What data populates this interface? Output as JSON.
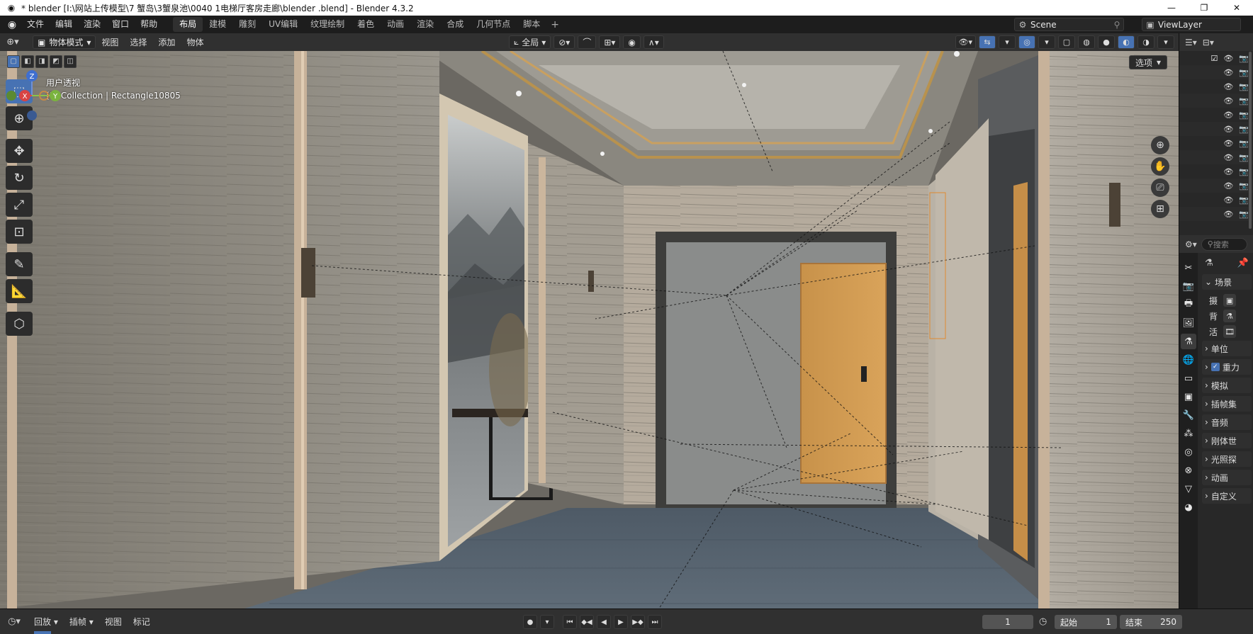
{
  "window": {
    "title": "* blender  [I:\\网站上传模型\\7 蟹岛\\3蟹泉池\\0040 1电梯厅客房走廊\\blender .blend] - Blender 4.3.2",
    "minimize": "—",
    "maximize": "❐",
    "close": "✕"
  },
  "menubar": {
    "items": [
      "文件",
      "编辑",
      "渲染",
      "窗口",
      "帮助"
    ],
    "workspaces": [
      "布局",
      "建模",
      "雕刻",
      "UV编辑",
      "纹理绘制",
      "着色",
      "动画",
      "渲染",
      "合成",
      "几何节点",
      "脚本"
    ],
    "active_workspace": "布局",
    "add_tab": "+",
    "scene": "Scene",
    "view_layer": "ViewLayer"
  },
  "viewport_header": {
    "mode": "物体模式",
    "menus": [
      "视图",
      "选择",
      "添加",
      "物体"
    ],
    "transform_orientation": "全局",
    "options": "选项"
  },
  "viewport": {
    "view_name": "用户透视",
    "collection_info": "(1) Collection | Rectangle10805",
    "gizmo_axes": {
      "x": "X",
      "y": "Y",
      "z": "Z"
    }
  },
  "toolbar": {
    "tools": [
      "select-box",
      "cursor",
      "move",
      "rotate",
      "scale",
      "transform",
      "annotate",
      "measure",
      "add-cube"
    ]
  },
  "outliner": {
    "rows": 12
  },
  "properties": {
    "search_placeholder": "搜索",
    "scene_header": "场景",
    "sub_rows": [
      "摄",
      "背",
      "活"
    ],
    "panels": [
      {
        "label": "单位",
        "checkbox": false
      },
      {
        "label": "重力",
        "checkbox": true
      },
      {
        "label": "模拟",
        "checkbox": false
      },
      {
        "label": "插帧集",
        "checkbox": false
      },
      {
        "label": "音频",
        "checkbox": false
      },
      {
        "label": "刚体世",
        "checkbox": false
      },
      {
        "label": "光照探",
        "checkbox": false
      },
      {
        "label": "动画",
        "checkbox": false
      },
      {
        "label": "自定义",
        "checkbox": false
      }
    ]
  },
  "timeline": {
    "menus": [
      "回放",
      "插帧",
      "视图",
      "标记"
    ],
    "current_frame": "1",
    "start_label": "起始",
    "start_value": "1",
    "end_label": "结束",
    "end_value": "250"
  }
}
